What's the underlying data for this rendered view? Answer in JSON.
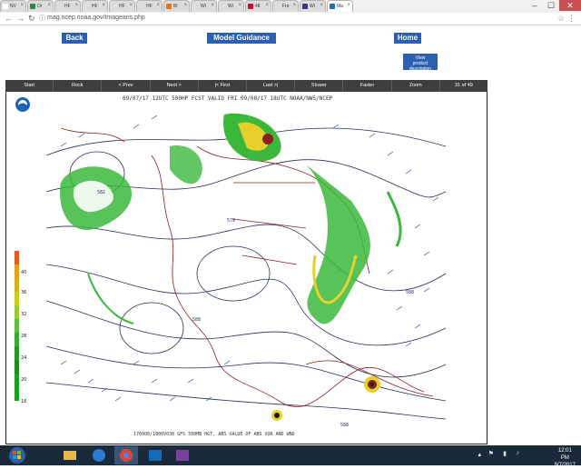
{
  "browser": {
    "tabs": [
      {
        "label": "NV",
        "color": "#ffffff"
      },
      {
        "label": "Or",
        "color": "#2b8a3e"
      },
      {
        "label": "HF",
        "color": "#dddddd"
      },
      {
        "label": "HF",
        "color": "#dddddd"
      },
      {
        "label": "HF",
        "color": "#dddddd"
      },
      {
        "label": "HF",
        "color": "#dddddd"
      },
      {
        "label": "Bl",
        "color": "#e8711c"
      },
      {
        "label": "Wi",
        "color": "#dddddd"
      },
      {
        "label": "Wi",
        "color": "#dddddd"
      },
      {
        "label": "48",
        "color": "#c8102e"
      },
      {
        "label": "Fre",
        "color": "#dddddd"
      },
      {
        "label": "Wi",
        "color": "#4b2e83"
      },
      {
        "label": "Ma",
        "color": "#1a6fb5",
        "active": true
      }
    ],
    "url": "mag.ncep.noaa.gov/Imagearis.php"
  },
  "page": {
    "back_label": "Back",
    "model_guidance_label": "Model Guidance",
    "home_label": "Home",
    "view_desc_line1": "View",
    "view_desc_line2": "product",
    "view_desc_line3": "description",
    "controls": [
      "Start",
      "Rock",
      "< Prev",
      "Next >",
      "|< First",
      "Last >|",
      "Slower",
      "Faster",
      "Zoom"
    ],
    "frame_counter": "31 of 49",
    "map_title": "09/07/17  12UTC  500HP  FCST VALID FRI 09/08/17 18UTC  NOAA/NWS/NCEP",
    "map_footer": "170908/1800V030 GFS 500MB HGT, ABS VALUE OF ABS VOR AND WND",
    "legend_ticks": [
      "40",
      "36",
      "32",
      "28",
      "24",
      "20",
      "16"
    ],
    "height_labels": [
      "582",
      "576",
      "588",
      "588",
      "588"
    ]
  },
  "taskbar": {
    "time": "12:01 PM",
    "date": "9/7/2017"
  }
}
